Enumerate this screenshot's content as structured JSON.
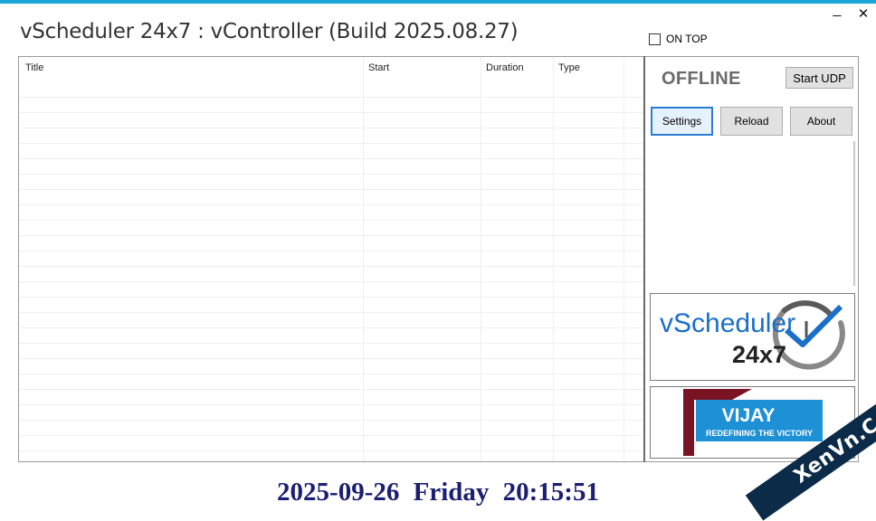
{
  "window": {
    "title": "vScheduler 24x7 : vController (Build 2025.08.27)",
    "minimize_glyph": "_",
    "close_glyph": "✕",
    "ontop_label": "ON TOP",
    "ontop_checked": false
  },
  "grid": {
    "columns": [
      "Title",
      "Start",
      "Duration",
      "Type"
    ],
    "rows": []
  },
  "panel": {
    "status": "OFFLINE",
    "start_udp_label": "Start UDP",
    "settings_label": "Settings",
    "reload_label": "Reload",
    "about_label": "About"
  },
  "logo": {
    "name": "vScheduler",
    "sub": "24x7",
    "icon": "clock-check-icon"
  },
  "banner": {
    "title": "VIJAY",
    "tagline": "REDEFINING THE VICTORY"
  },
  "clock": {
    "date": "2025-09-26",
    "day": "Friday",
    "time": "20:15:51"
  },
  "watermark": {
    "text": "XenVn.Com"
  },
  "colors": {
    "accent": "#1aa6d6",
    "clock_text": "#1b1f73",
    "logo_blue": "#1a6fc9",
    "banner_blue": "#1e90d6",
    "banner_maroon": "#7a1424"
  }
}
